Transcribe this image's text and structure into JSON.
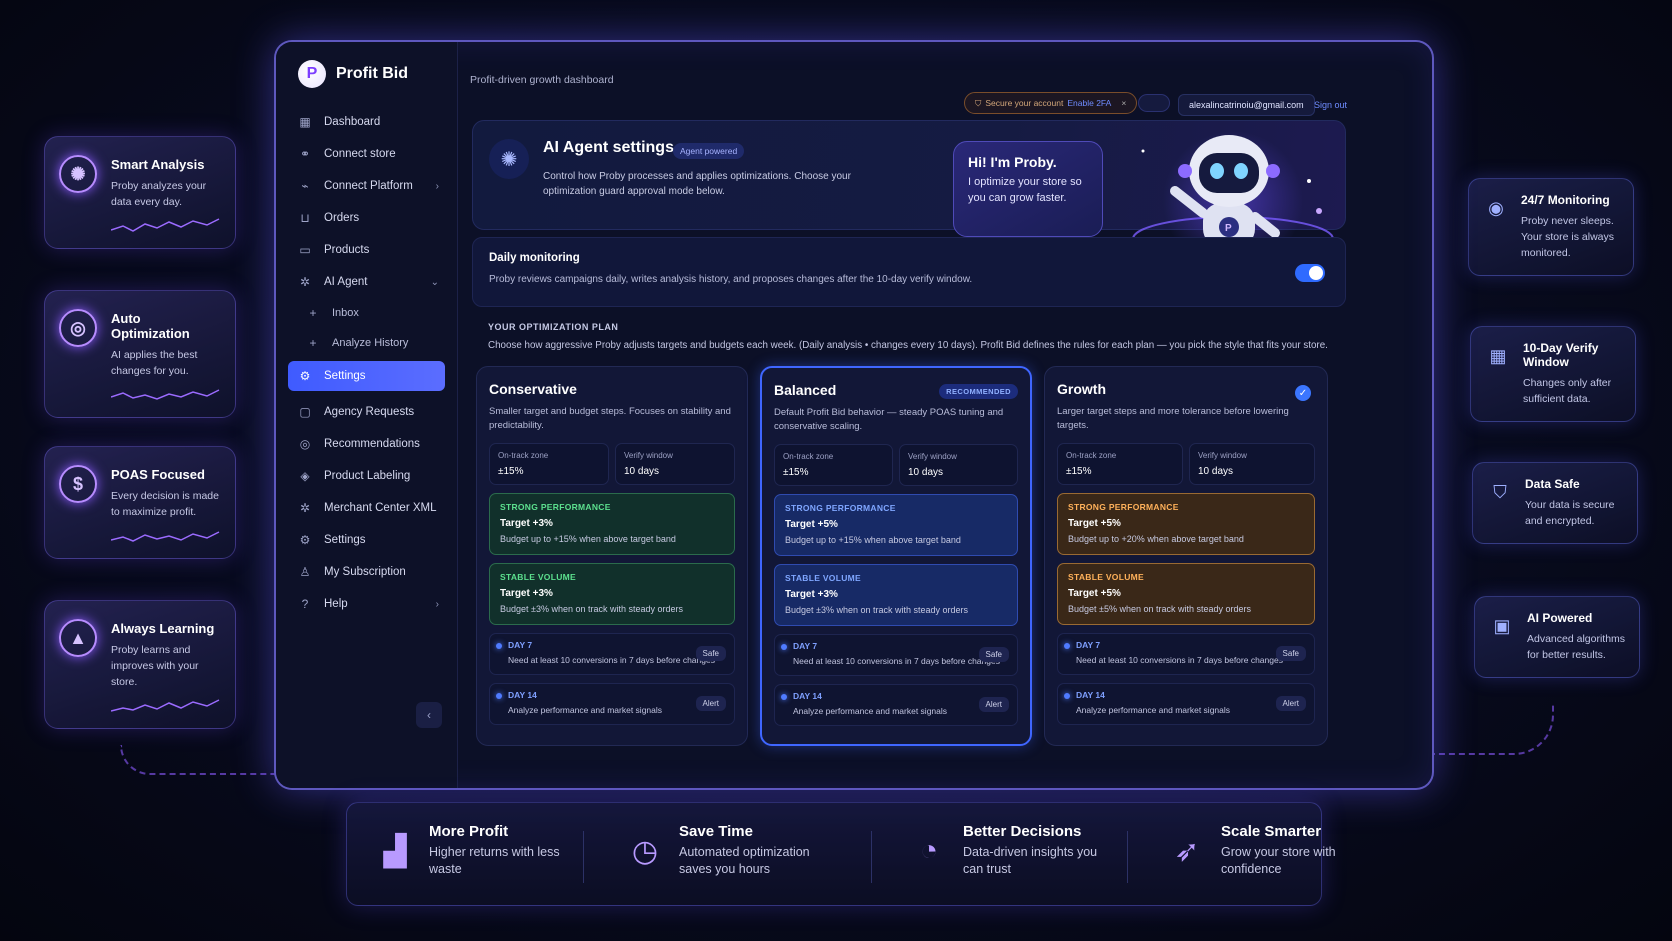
{
  "app": {
    "name": "Profit Bid",
    "logo_letter": "P"
  },
  "sidebar": {
    "items": [
      {
        "label": "Dashboard",
        "icon": "grid-icon"
      },
      {
        "label": "Connect store",
        "icon": "link-icon"
      },
      {
        "label": "Connect Platform",
        "icon": "plug-icon"
      },
      {
        "label": "Orders",
        "icon": "cart-icon"
      },
      {
        "label": "Products",
        "icon": "box-icon"
      },
      {
        "label": "AI Agent",
        "icon": "chip-icon"
      },
      {
        "label": "Inbox",
        "icon": "plus-icon"
      },
      {
        "label": "Analyze History",
        "icon": "plus-icon"
      },
      {
        "label": "Settings",
        "icon": "gear-icon"
      },
      {
        "label": "Agency Requests",
        "icon": "folder-icon"
      },
      {
        "label": "Recommendations",
        "icon": "target-icon"
      },
      {
        "label": "Product Labeling",
        "icon": "tag-icon"
      },
      {
        "label": "Merchant Center XML",
        "icon": "code-icon"
      },
      {
        "label": "Settings",
        "icon": "gear-icon"
      },
      {
        "label": "My Subscription",
        "icon": "user-icon"
      },
      {
        "label": "Help",
        "icon": "help-icon"
      }
    ]
  },
  "topbar": {
    "breadcrumb": "Profit-driven growth dashboard",
    "security": {
      "text": "Secure your account",
      "link": "Enable 2FA",
      "close": "×"
    },
    "email": "alexalincatrinoiu@gmail.com",
    "signout": "Sign out"
  },
  "agent": {
    "title": "AI Agent settings",
    "badge": "Agent powered",
    "description": "Control how Proby processes and applies optimizations. Choose your optimization guard approval mode below.",
    "bubble_title": "Hi! I'm Proby.",
    "bubble_text": "I optimize your store so you can grow faster."
  },
  "daily": {
    "title": "Daily monitoring",
    "text": "Proby reviews campaigns daily, writes analysis history, and proposes changes after the 10-day verify window.",
    "enabled": true
  },
  "plan": {
    "heading": "YOUR OPTIMIZATION PLAN",
    "description": "Choose how aggressive Proby adjusts targets and budgets each week. (Daily analysis • changes every 10 days). Profit Bid defines the rules for each plan — you pick the style that fits your store.",
    "cards": [
      {
        "name": "Conservative",
        "badge": "",
        "description": "Smaller target and budget steps. Focuses on stability and predictability.",
        "zone_label": "On-track zone",
        "zone_value": "±15%",
        "window_label": "Verify window",
        "window_value": "10 days",
        "strong_label": "STRONG PERFORMANCE",
        "strong_target": "Target +3%",
        "strong_desc": "Budget up to +15% when above target band",
        "stable_label": "STABLE VOLUME",
        "stable_target": "Target +3%",
        "stable_desc": "Budget ±3% when on track with steady orders",
        "day7": "DAY 7",
        "day7_desc": "Need at least 10 conversions in 7 days before changes",
        "day7_tag": "Safe",
        "day14": "DAY 14",
        "day14_desc": "Analyze performance and market signals",
        "day14_tag": "Alert"
      },
      {
        "name": "Balanced",
        "badge": "RECOMMENDED",
        "description": "Default Profit Bid behavior — steady POAS tuning and conservative scaling.",
        "zone_label": "On-track zone",
        "zone_value": "±15%",
        "window_label": "Verify window",
        "window_value": "10 days",
        "strong_label": "STRONG PERFORMANCE",
        "strong_target": "Target +5%",
        "strong_desc": "Budget up to +15% when above target band",
        "stable_label": "STABLE VOLUME",
        "stable_target": "Target +3%",
        "stable_desc": "Budget ±3% when on track with steady orders",
        "day7": "DAY 7",
        "day7_desc": "Need at least 10 conversions in 7 days before changes",
        "day7_tag": "Safe",
        "day14": "DAY 14",
        "day14_desc": "Analyze performance and market signals",
        "day14_tag": "Alert"
      },
      {
        "name": "Growth",
        "badge": "",
        "description": "Larger target steps and more tolerance before lowering targets.",
        "zone_label": "On-track zone",
        "zone_value": "±15%",
        "window_label": "Verify window",
        "window_value": "10 days",
        "strong_label": "STRONG PERFORMANCE",
        "strong_target": "Target +5%",
        "strong_desc": "Budget up to +20% when above target band",
        "stable_label": "STABLE VOLUME",
        "stable_target": "Target +5%",
        "stable_desc": "Budget ±5% when on track with steady orders",
        "day7": "DAY 7",
        "day7_desc": "Need at least 10 conversions in 7 days before changes",
        "day7_tag": "Safe",
        "day14": "DAY 14",
        "day14_desc": "Analyze performance and market signals",
        "day14_tag": "Alert"
      }
    ]
  },
  "left_features": [
    {
      "title": "Smart Analysis",
      "text": "Proby analyzes your data every day.",
      "icon": "brain-icon"
    },
    {
      "title": "Auto Optimization",
      "text": "AI applies the best changes for you.",
      "icon": "target-icon"
    },
    {
      "title": "POAS Focused",
      "text": "Every decision is made to maximize profit.",
      "icon": "dollar-icon"
    },
    {
      "title": "Always Learning",
      "text": "Proby learns and improves with your store.",
      "icon": "graduation-cap-icon"
    }
  ],
  "right_features": [
    {
      "title": "24/7 Monitoring",
      "text": "Proby never sleeps. Your store is always monitored.",
      "icon": "eye-icon"
    },
    {
      "title": "10-Day Verify Window",
      "text": "Changes only after sufficient data.",
      "icon": "calendar-icon"
    },
    {
      "title": "Data Safe",
      "text": "Your data is secure and encrypted.",
      "icon": "shield-icon"
    },
    {
      "title": "AI Powered",
      "text": "Advanced algorithms for better results.",
      "icon": "chip-icon"
    }
  ],
  "benefits": [
    {
      "title": "More Profit",
      "text": "Higher returns with less waste",
      "icon": "bar-chart-icon"
    },
    {
      "title": "Save Time",
      "text": "Automated optimization saves you hours",
      "icon": "clock-icon"
    },
    {
      "title": "Better Decisions",
      "text": "Data-driven insights you can trust",
      "icon": "pie-chart-icon"
    },
    {
      "title": "Scale Smarter",
      "text": "Grow your store with confidence",
      "icon": "rocket-icon"
    }
  ],
  "colors": {
    "accent": "#4f6bff",
    "glow": "#8c5bff",
    "green": "#5ce08e",
    "orange": "#ffb15a"
  }
}
